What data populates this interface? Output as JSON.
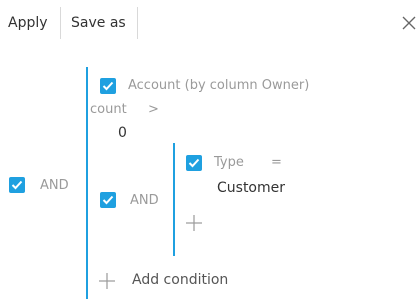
{
  "toolbar": {
    "apply_label": "Apply",
    "save_as_label": "Save as",
    "close_icon": "close-icon"
  },
  "filter": {
    "root": {
      "checked": true,
      "operator_label": "AND",
      "condition": {
        "checked": true,
        "column": "Account (by column Owner)",
        "aggregate": "count",
        "comparison": ">",
        "value": "0"
      },
      "group": {
        "checked": true,
        "operator_label": "AND",
        "condition": {
          "checked": true,
          "column": "Type",
          "comparison": "=",
          "value": "Customer"
        }
      },
      "add_condition_label": "Add condition"
    }
  },
  "colors": {
    "accent": "#1fa0e0",
    "separator": "#d9d9d9",
    "muted_text": "#9a9a9a"
  }
}
